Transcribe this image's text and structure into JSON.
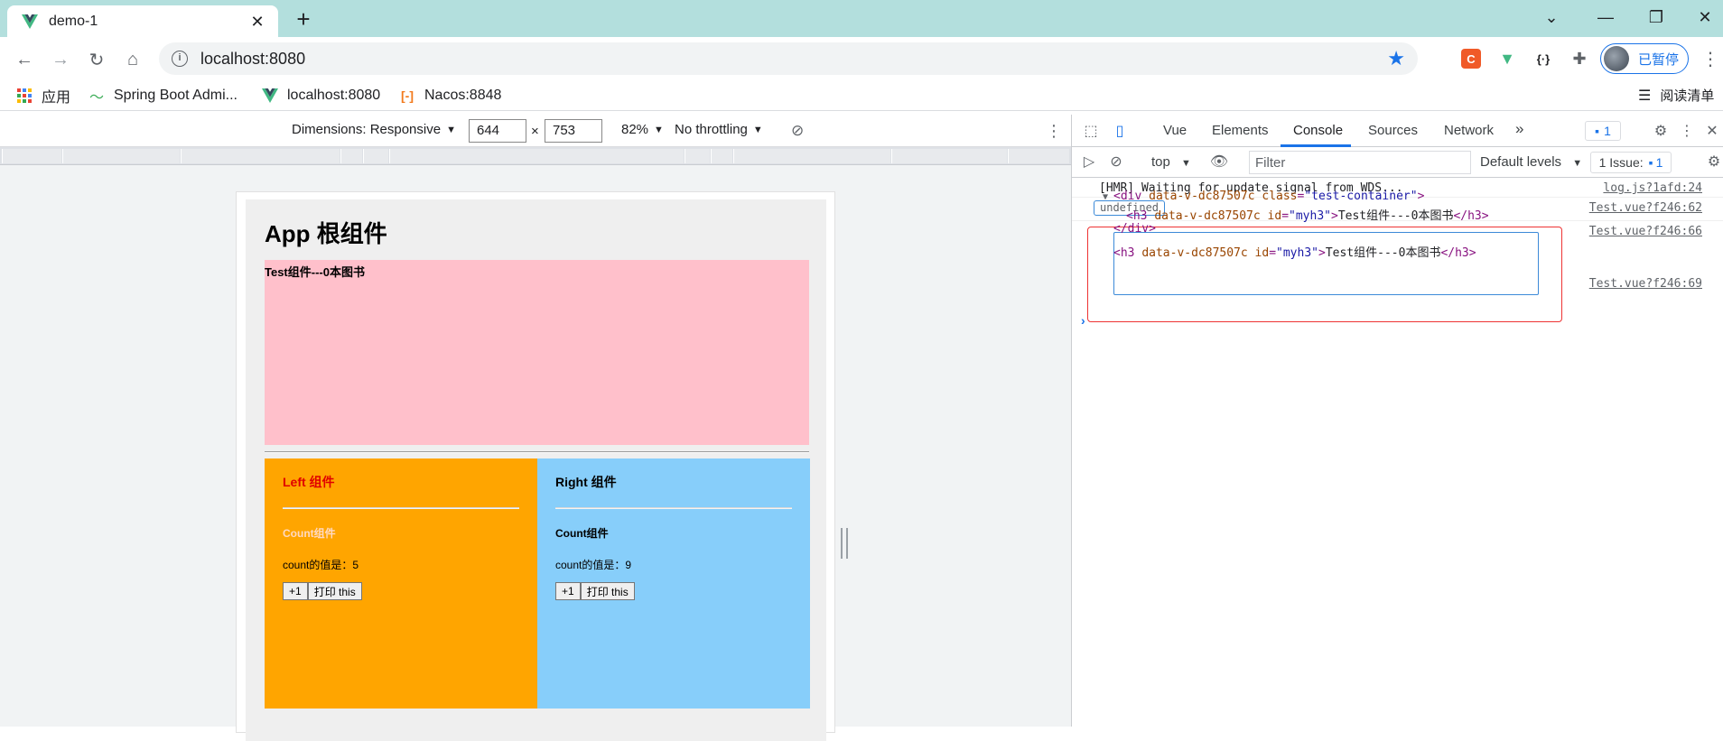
{
  "tab": {
    "title": "demo-1"
  },
  "address": {
    "url": "localhost:8080"
  },
  "profile": {
    "status": "已暂停"
  },
  "bookmarks": [
    {
      "label": "应用"
    },
    {
      "label": "Spring Boot Admi..."
    },
    {
      "label": "localhost:8080"
    },
    {
      "label": "Nacos:8848"
    }
  ],
  "reading_list": "阅读清单",
  "device_toolbar": {
    "dimensions": "Dimensions: Responsive",
    "width": "644",
    "times": "×",
    "height": "753",
    "zoom": "82%",
    "throttling": "No throttling"
  },
  "app": {
    "title": "App 根组件",
    "test_heading": "Test组件---0本图书",
    "left": {
      "title": "Left 组件",
      "count_title": "Count组件",
      "count_text": "count的值是：5",
      "btn_plus": "+1",
      "btn_print": "打印 this"
    },
    "right": {
      "title": "Right 组件",
      "count_title": "Count组件",
      "count_text": "count的值是：9",
      "btn_plus": "+1",
      "btn_print": "打印 this"
    }
  },
  "devtools": {
    "tabs": [
      "Vue",
      "Elements",
      "Console",
      "Sources",
      "Network"
    ],
    "active_tab": "Console",
    "more": "»",
    "msg_count": "1",
    "context": "top",
    "filter_placeholder": "Filter",
    "levels": "Default levels",
    "issues": "1 Issue:",
    "issues_count": "1"
  },
  "console": {
    "hmr": "[HMR] Waiting for update signal from WDS...",
    "hmr_src": "log.js?1afd:24",
    "undefined": "undefined",
    "undefined_src": "Test.vue?f246:62",
    "div_src": "Test.vue?f246:66",
    "h3_src": "Test.vue?f246:69",
    "div_open_tag": "div",
    "div_attr1": "data-v-dc87507c",
    "div_attr2_name": "class",
    "div_attr2_value": "\"test-container\"",
    "h3_tag": "h3",
    "h3_attr1": "data-v-dc87507c",
    "h3_attr2_name": "id",
    "h3_attr2_value": "\"myh3\"",
    "h3_text": "Test组件---0本图书",
    "h3_close": "</h3>",
    "div_close": "</div>"
  },
  "colors": {
    "accent": "#1a73e8",
    "pink": "#ffc0cb",
    "orange": "#ffa500",
    "light_blue": "#87cefa",
    "annotation_red": "#e33333"
  }
}
